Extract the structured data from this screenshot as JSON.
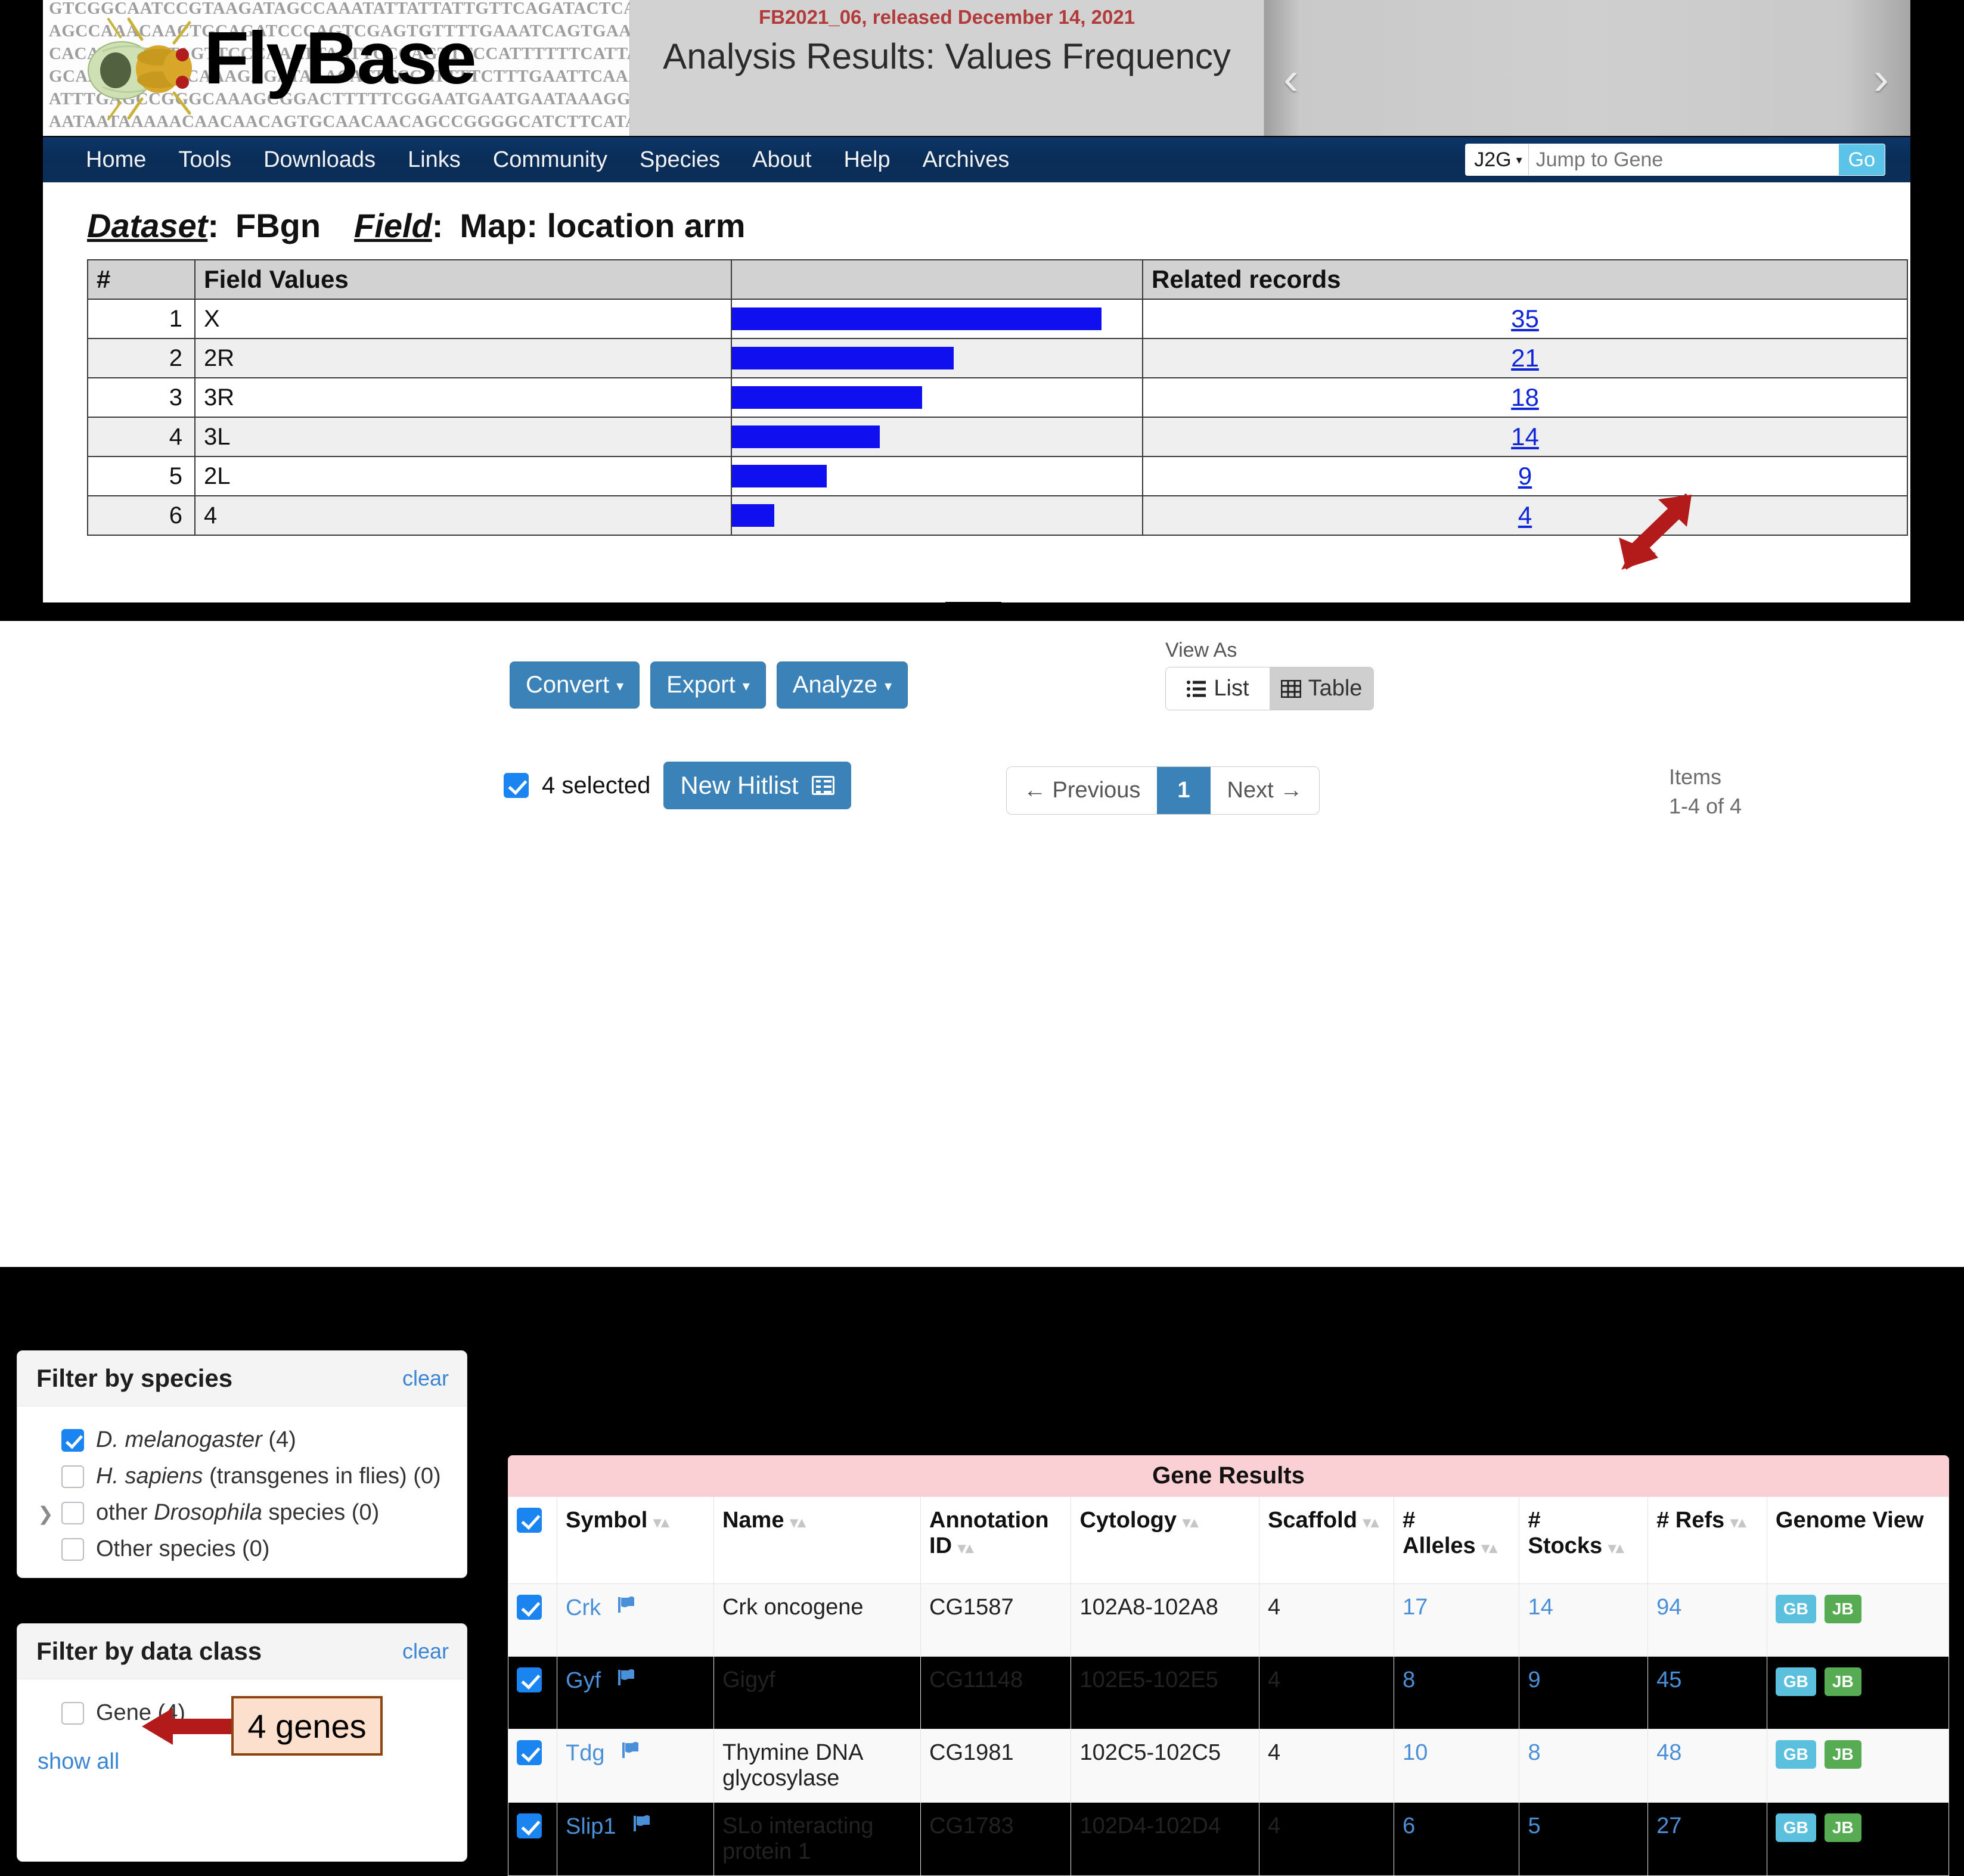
{
  "masthead": {
    "logo_text": "FlyBase",
    "dna_lines": [
      "GTCGGCAATCCGTAAGATAGCCAAATATTATTATTGTTCAGATACTCAC",
      "AGCCAAACAACTGCAGATCCCAGTCGAGTGTTTTGAAATCAGTGAAATT",
      "CACATTTATTTAGTTCCCAAATTAATTCCCAGTTTCCATTTTTTCATTA",
      "GCAAATCGAATCAAAGAGATAAACATTTCCATTTTCTTTGAATTCAAAT",
      "ATTTGAGCCGGGCAAAGCGGACTTTTTCGGAATGAATGAATAAAGGAAA",
      "AATAATAAAAACAACAACAGTGCAACAACAGCCGGGGCATCTTCATAGA"
    ],
    "release": "FB2021_06, released December 14, 2021",
    "page_title": "Analysis Results: Values Frequency",
    "carousel_prev": "‹",
    "carousel_next": "›"
  },
  "nav": {
    "items": [
      "Home",
      "Tools",
      "Downloads",
      "Links",
      "Community",
      "Species",
      "About",
      "Help",
      "Archives"
    ],
    "j2g_label": "J2G",
    "j2g_caret": "▾",
    "j2g_placeholder": "Jump to Gene",
    "j2g_value": "",
    "go_label": "Go"
  },
  "analysis": {
    "dataset_label": "Dataset",
    "dataset_value": "FBgn",
    "field_label": "Field",
    "field_value": "Map: location arm",
    "colon": ":"
  },
  "chart_data": {
    "type": "bar",
    "title": "Analysis Results: Values Frequency",
    "xlabel": "Related records",
    "ylabel": "Field Values",
    "categories": [
      "X",
      "2R",
      "3R",
      "3L",
      "2L",
      "4"
    ],
    "values": [
      35,
      21,
      18,
      14,
      9,
      4
    ],
    "ranks": [
      1,
      2,
      3,
      4,
      5,
      6
    ],
    "headers": [
      "#",
      "Field Values",
      "",
      "Related records"
    ],
    "bar_color": "#0f0ff0",
    "max_value": 35,
    "grid": false,
    "legend": "none",
    "orientation": "horizontal"
  },
  "annotations": {
    "arrow_to_4_color": "#b31b1b",
    "callout_genes_text": "4 genes",
    "callout_bg": "#fce0cd",
    "callout_border": "#8c4413",
    "arrow_genes_color": "#b31b1b",
    "down_arrow_color": "#000000"
  },
  "toolbar": {
    "convert_label": "Convert",
    "export_label": "Export",
    "analyze_label": "Analyze",
    "caret": "▾"
  },
  "view_as": {
    "label": "View As",
    "list_label": "List",
    "table_label": "Table",
    "active": "Table"
  },
  "selection": {
    "selected_text": "4 selected",
    "new_hitlist_label": "New Hitlist"
  },
  "pagination": {
    "previous_label": "← Previous",
    "current_page": "1",
    "next_label": "Next →",
    "items_label": "Items",
    "items_range": "1-4 of 4"
  },
  "filters": {
    "species": {
      "title": "Filter by species",
      "clear": "clear",
      "rows": [
        {
          "label_it": "D. melanogaster",
          "label_rest": " (4)",
          "checked": true,
          "disclosure": false
        },
        {
          "label_it": "H. sapiens",
          "label_rest": " (transgenes in flies) (0)",
          "checked": false,
          "disclosure": false
        },
        {
          "label_pre": "other ",
          "label_it": "Drosophila",
          "label_rest": " species (0)",
          "checked": false,
          "disclosure": true
        },
        {
          "label_rest": "Other species (0)",
          "checked": false,
          "disclosure": false
        }
      ]
    },
    "data_class": {
      "title": "Filter by data class",
      "clear": "clear",
      "rows": [
        {
          "label_rest": "Gene (4)",
          "checked": false,
          "disclosure": false
        }
      ],
      "show_all": "show all"
    }
  },
  "results": {
    "banner": "Gene Results",
    "columns": [
      {
        "label": "",
        "sortable": false
      },
      {
        "label": "Symbol",
        "sortable": true
      },
      {
        "label": "Name",
        "sortable": true
      },
      {
        "label": "Annotation ID",
        "sortable": true
      },
      {
        "label": "Cytology",
        "sortable": true
      },
      {
        "label": "Scaffold",
        "sortable": true
      },
      {
        "label": "# Alleles",
        "sortable": true
      },
      {
        "label": "# Stocks",
        "sortable": true
      },
      {
        "label": "# Refs",
        "sortable": true
      },
      {
        "label": "Genome View",
        "sortable": false
      }
    ],
    "rows": [
      {
        "checked": true,
        "symbol": "Crk",
        "name": "Crk oncogene",
        "annotation_id": "CG1587",
        "cytology": "102A8-102A8",
        "scaffold": "4",
        "alleles": "17",
        "stocks": "14",
        "refs": "94",
        "gb": "GB",
        "jb": "JB"
      },
      {
        "checked": true,
        "symbol": "Gyf",
        "name": "Gigyf",
        "annotation_id": "CG11148",
        "cytology": "102E5-102E5",
        "scaffold": "4",
        "alleles": "8",
        "stocks": "9",
        "refs": "45",
        "gb": "GB",
        "jb": "JB"
      },
      {
        "checked": true,
        "symbol": "Tdg",
        "name": "Thymine DNA glycosylase",
        "annotation_id": "CG1981",
        "cytology": "102C5-102C5",
        "scaffold": "4",
        "alleles": "10",
        "stocks": "8",
        "refs": "48",
        "gb": "GB",
        "jb": "JB"
      },
      {
        "checked": true,
        "symbol": "Slip1",
        "name": "SLo interacting protein 1",
        "annotation_id": "CG1783",
        "cytology": "102D4-102D4",
        "scaffold": "4",
        "alleles": "6",
        "stocks": "5",
        "refs": "27",
        "gb": "GB",
        "jb": "JB"
      }
    ],
    "sort_arrows": "▾▴"
  },
  "colors": {
    "nav_bg": "#0b2f59",
    "accent_blue": "#3b82b8",
    "link_blue": "#4a90d9",
    "bar_blue": "#0f0ff0",
    "banner_pink": "#fbd0d4",
    "release_red": "#b23a3a"
  }
}
